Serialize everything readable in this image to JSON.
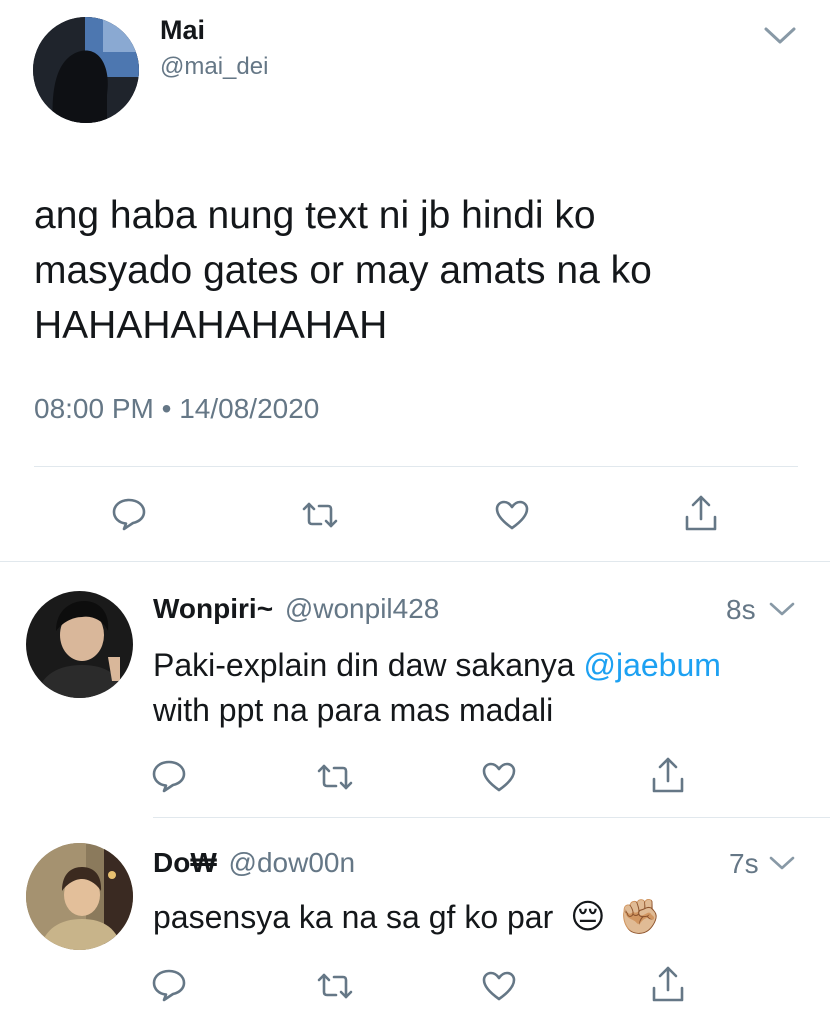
{
  "main_tweet": {
    "author_name": "Mai",
    "author_handle": "@mai_dei",
    "text_line1": "ang haba nung text ni jb hindi ko",
    "text_line2": "masyado gates or may amats na ko",
    "text_line3": "HAHAHAHAHAHAH",
    "time": "08:00 PM",
    "separator": "•",
    "date": "14/08/2020"
  },
  "replies": [
    {
      "author_name": "Wonpiri~",
      "author_handle": "@wonpil428",
      "age": "8s",
      "text_line1_prefix": "Paki-explain din daw sakanya ",
      "mention": "@jaebum",
      "text_line2": "with ppt na para mas madali"
    },
    {
      "author_name": "Do₩",
      "author_handle": "@dow00n",
      "age": "7s",
      "text_line1": "pasensya ka na sa gf ko par",
      "emoji1": "😔",
      "emoji2": "✊🏼"
    }
  ],
  "icons": {
    "reply": "speech-bubble-icon",
    "retweet": "retweet-icon",
    "like": "heart-icon",
    "share": "share-icon",
    "more": "chevron-down-icon"
  },
  "colors": {
    "text": "#14171a",
    "muted": "#657786",
    "link": "#1da1f2",
    "divider": "#e1e8ed"
  }
}
